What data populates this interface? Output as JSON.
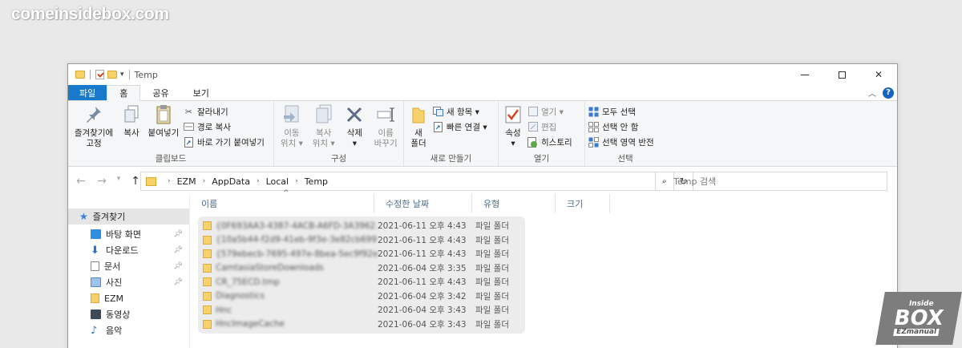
{
  "watermark": "comeinsidebox.com",
  "window": {
    "title": "Temp"
  },
  "tabs": [
    "파일",
    "홈",
    "공유",
    "보기"
  ],
  "ribbon": {
    "clipboard": {
      "pin_label_1": "즐겨찾기에",
      "pin_label_2": "고정",
      "copy": "복사",
      "paste": "붙여넣기",
      "cut": "잘라내기",
      "copy_path": "경로 복사",
      "paste_shortcut": "바로 가기 붙여넣기",
      "label": "클립보드"
    },
    "organize": {
      "move_1": "이동",
      "move_2": "위치 ▾",
      "copyto_1": "복사",
      "copyto_2": "위치 ▾",
      "delete_1": "삭제",
      "delete_2": "▾",
      "rename_1": "이름",
      "rename_2": "바꾸기",
      "label": "구성"
    },
    "new": {
      "folder_1": "새",
      "folder_2": "폴더",
      "new_item": "새 항목 ▾",
      "easy_access": "빠른 연결 ▾",
      "label": "새로 만들기"
    },
    "open": {
      "properties": "속성",
      "properties_arrow": "▾",
      "open": "열기 ▾",
      "edit": "편집",
      "history": "히스토리",
      "label": "열기"
    },
    "select": {
      "select_all": "모두 선택",
      "select_none": "선택 안 함",
      "invert": "선택 영역 반전",
      "label": "선택"
    }
  },
  "address": {
    "crumbs": [
      "EZM",
      "AppData",
      "Local",
      "Temp"
    ],
    "search_placeholder": "Temp 검색"
  },
  "sidebar": {
    "head": "즐겨찾기",
    "items": [
      {
        "label": "바탕 화면",
        "pinned": true
      },
      {
        "label": "다운로드",
        "pinned": true
      },
      {
        "label": "문서",
        "pinned": true
      },
      {
        "label": "사진",
        "pinned": true
      },
      {
        "label": "EZM",
        "pinned": false
      },
      {
        "label": "동영상",
        "pinned": false
      },
      {
        "label": "음악",
        "pinned": false
      }
    ]
  },
  "columns": [
    "이름",
    "수정한 날짜",
    "유형",
    "크기"
  ],
  "files": [
    {
      "name": "{0F693AA3-4387-4ACB-A6FD-3A3962...",
      "date": "2021-06-11 오후 4:43",
      "type": "파일 폴더"
    },
    {
      "name": "{10a5b44-f2d9-41eb-9f3e-3e82cb699...",
      "date": "2021-06-11 오후 4:43",
      "type": "파일 폴더"
    },
    {
      "name": "{579ebecb-7695-497e-8bea-5ec9f92e...",
      "date": "2021-06-11 오후 4:43",
      "type": "파일 폴더"
    },
    {
      "name": "CamtasiaStoreDownloads",
      "date": "2021-06-04 오후 3:35",
      "type": "파일 폴더"
    },
    {
      "name": "CR_75ECD.tmp",
      "date": "2021-06-11 오후 4:43",
      "type": "파일 폴더"
    },
    {
      "name": "Diagnostics",
      "date": "2021-06-04 오후 3:42",
      "type": "파일 폴더"
    },
    {
      "name": "Hnc",
      "date": "2021-06-04 오후 3:43",
      "type": "파일 폴더"
    },
    {
      "name": "HncImageCache",
      "date": "2021-06-04 오후 3:43",
      "type": "파일 폴더"
    }
  ],
  "logo": {
    "line1": "Inside",
    "line2": "BOX",
    "line3": "EZmanual"
  }
}
